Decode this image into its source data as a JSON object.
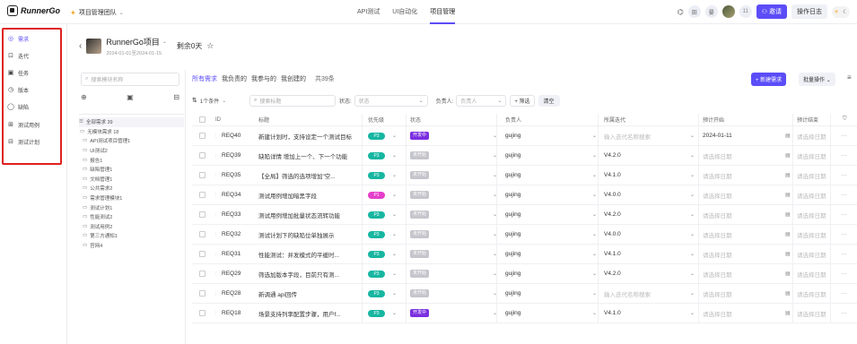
{
  "topbar": {
    "logo": "RunnerGo",
    "team": "项目管理团队",
    "nav": [
      "API测试",
      "UI自动化",
      "项目管理"
    ],
    "active_nav": "项目管理",
    "user_badges": [
      "田",
      "晏"
    ],
    "member_count": "11",
    "invite_label": "邀请",
    "oplog_label": "操作日志"
  },
  "leftnav": {
    "items": [
      {
        "label": "需求",
        "icon": "requirement-icon",
        "glyph": "◎",
        "active": true
      },
      {
        "label": "迭代",
        "icon": "iteration-icon",
        "glyph": "⊡",
        "active": false
      },
      {
        "label": "任务",
        "icon": "task-icon",
        "glyph": "▣",
        "active": false
      },
      {
        "label": "版本",
        "icon": "version-icon",
        "glyph": "◷",
        "active": false
      },
      {
        "label": "缺陷",
        "icon": "bug-icon",
        "glyph": "◯",
        "active": false
      },
      {
        "label": "测试用例",
        "icon": "testcase-icon",
        "glyph": "⊞",
        "active": false
      },
      {
        "label": "测试计划",
        "icon": "testplan-icon",
        "glyph": "⊟",
        "active": false
      }
    ]
  },
  "project": {
    "name": "RunnerGo项目",
    "dates": "2024-01-01至2024-01-15",
    "remaining": "剩余0天"
  },
  "modules": {
    "search_placeholder": "搜索模块名称",
    "items": [
      {
        "label": "全部需求 39",
        "level": "all",
        "glyph": "☰"
      },
      {
        "label": "无模块需求 18",
        "level": "l0",
        "glyph": "▭"
      },
      {
        "label": "API测试项目管理1",
        "level": "l1",
        "glyph": "▭"
      },
      {
        "label": "UI测试2",
        "level": "l1",
        "glyph": "▭"
      },
      {
        "label": "报告1",
        "level": "l1",
        "glyph": "▭"
      },
      {
        "label": "缺陷管理1",
        "level": "l1",
        "glyph": "▭"
      },
      {
        "label": "文档管理1",
        "level": "l1",
        "glyph": "▭"
      },
      {
        "label": "公共需求2",
        "level": "l1",
        "glyph": "▭"
      },
      {
        "label": "需求管理模块1",
        "level": "l1",
        "glyph": "▭"
      },
      {
        "label": "测试计划1",
        "level": "l1",
        "glyph": "▭"
      },
      {
        "label": "性能测试2",
        "level": "l1",
        "glyph": "▭"
      },
      {
        "label": "测试用例2",
        "level": "l1",
        "glyph": "▭"
      },
      {
        "label": "第三方通知1",
        "level": "l1",
        "glyph": "▭"
      },
      {
        "label": "官网4",
        "level": "l1",
        "glyph": "▭"
      }
    ]
  },
  "main": {
    "tabs": [
      "所有需求",
      "我负责的",
      "我参与的",
      "我创建的"
    ],
    "active_tab": "所有需求",
    "total": "共39条",
    "new_label": "+ 新建需求",
    "batch_label": "批量操作",
    "filter": {
      "condition": "1个条件",
      "search_placeholder": "搜索标题",
      "status_label": "状态:",
      "status_placeholder": "状态",
      "owner_label": "负责人:",
      "owner_placeholder": "负责人",
      "add_filter": "+ 筛选",
      "clear": "清空"
    },
    "columns": [
      "ID",
      "标题",
      "优先级",
      "状态",
      "负责人",
      "所属迭代",
      "预计开始",
      "预计结束"
    ],
    "rows": [
      {
        "id": "REQ40",
        "title": "新建计划时，支持设定一个测试目标",
        "pri": "P3",
        "status": "开发中",
        "owner": "gujing",
        "iter": "输入迭代名称搜索",
        "start": "2024-01-11",
        "end": "请选择日期"
      },
      {
        "id": "REQ39",
        "title": "缺陷详情 增加上一个、下一个功能",
        "pri": "P3",
        "status": "未开始",
        "owner": "gujing",
        "iter": "V4.2.0",
        "start": "请选择日期",
        "end": "请选择日期"
      },
      {
        "id": "REQ35",
        "title": "【全局】筛选的选项增加\"空...",
        "pri": "P3",
        "status": "未开始",
        "owner": "gujing",
        "iter": "V4.1.0",
        "start": "请选择日期",
        "end": "请选择日期"
      },
      {
        "id": "REQ34",
        "title": "测试用例增加暗黑字段",
        "pri": "P1",
        "status": "未开始",
        "owner": "gujing",
        "iter": "V4.0.0",
        "start": "请选择日期",
        "end": "请选择日期"
      },
      {
        "id": "REQ33",
        "title": "测试用例增加批量状态流转功能",
        "pri": "P3",
        "status": "未开始",
        "owner": "gujing",
        "iter": "V4.2.0",
        "start": "请选择日期",
        "end": "请选择日期"
      },
      {
        "id": "REQ32",
        "title": "测试计划下的缺陷位单独展示",
        "pri": "P3",
        "status": "未开始",
        "owner": "gujing",
        "iter": "V4.0.0",
        "start": "请选择日期",
        "end": "请选择日期"
      },
      {
        "id": "REQ31",
        "title": "性能测试：并发模式的平缓时...",
        "pri": "P3",
        "status": "未开始",
        "owner": "gujing",
        "iter": "V4.1.0",
        "start": "请选择日期",
        "end": "请选择日期"
      },
      {
        "id": "REQ29",
        "title": "筛选加版本字段，目前只有测...",
        "pri": "P3",
        "status": "未开始",
        "owner": "gujing",
        "iter": "V4.2.0",
        "start": "请选择日期",
        "end": "请选择日期"
      },
      {
        "id": "REQ28",
        "title": "新调通 api回传",
        "pri": "P3",
        "status": "未开始",
        "owner": "gujing",
        "iter": "输入迭代名称搜索",
        "start": "请选择日期",
        "end": "请选择日期"
      },
      {
        "id": "REQ18",
        "title": "场景支持列率配置步骤，用户f...",
        "pri": "P3",
        "status": "开发中",
        "owner": "gujing",
        "iter": "V4.1.0",
        "start": "请选择日期",
        "end": "请选择日期"
      }
    ]
  },
  "colors": {
    "accent": "#5b4df7",
    "p3": "#17b6a1",
    "p1": "#e53ecb",
    "status_dev": "#7b2fe0",
    "status_todo": "#c5c5cc",
    "highlight_box": "#e02020"
  }
}
